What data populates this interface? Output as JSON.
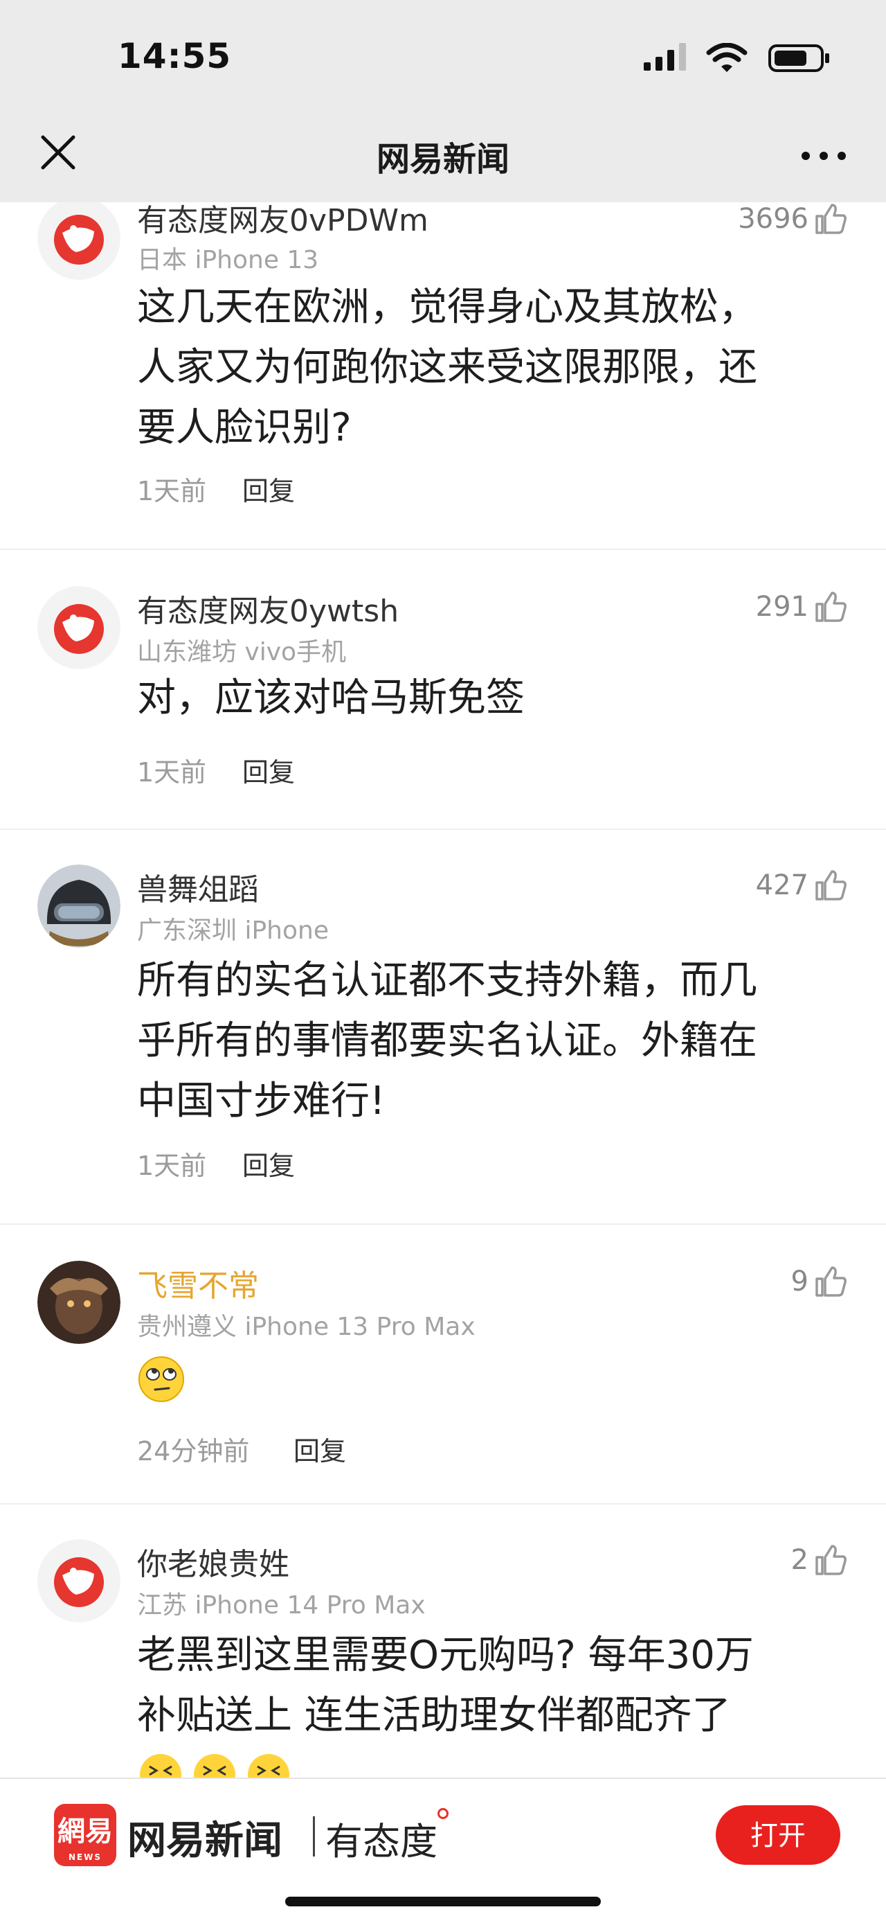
{
  "status_bar": {
    "time": "14:55"
  },
  "header": {
    "title": "网易新闻"
  },
  "comments": [
    {
      "username": "有态度网友0vPDWm",
      "device": "日本 iPhone 13",
      "likes": "3696",
      "lines": [
        "这几天在欧洲，觉得身心及其放松，",
        "人家又为何跑你这来受这限那限，还",
        "要人脸识别?"
      ],
      "time": "1天前",
      "reply": "回复"
    },
    {
      "username": "有态度网友0ywtsh",
      "device": "山东潍坊 vivo手机",
      "likes": "291",
      "lines": [
        "对，应该对哈马斯免签"
      ],
      "time": "1天前",
      "reply": "回复"
    },
    {
      "username": "兽舞俎蹈",
      "device": "广东深圳 iPhone",
      "likes": "427",
      "lines": [
        "所有的实名认证都不支持外籍，而几",
        "乎所有的事情都要实名认证。外籍在",
        "中国寸步难行!"
      ],
      "time": "1天前",
      "reply": "回复"
    },
    {
      "username": "飞雪不常",
      "device": "贵州遵义 iPhone 13 Pro Max",
      "likes": "9",
      "emoji": "eye-roll-emoji",
      "time": "24分钟前",
      "reply": "回复"
    },
    {
      "username": "你老娘贵姓",
      "device": "江苏 iPhone 14 Pro Max",
      "likes": "2",
      "lines": [
        "老黑到这里需要O元购吗?  每年30万",
        "补贴送上 连生活助理女伴都配齐了"
      ],
      "emoji": "laughing-emoji"
    }
  ],
  "bottom_bar": {
    "logo_text": "網易",
    "logo_sub": "NEWS",
    "brand": "网易新闻",
    "slogan": "有态度",
    "open_label": "打开"
  },
  "colors": {
    "brand_red": "#e8211e",
    "gold_username": "#e6a531",
    "muted_text": "#a3a3a3"
  }
}
